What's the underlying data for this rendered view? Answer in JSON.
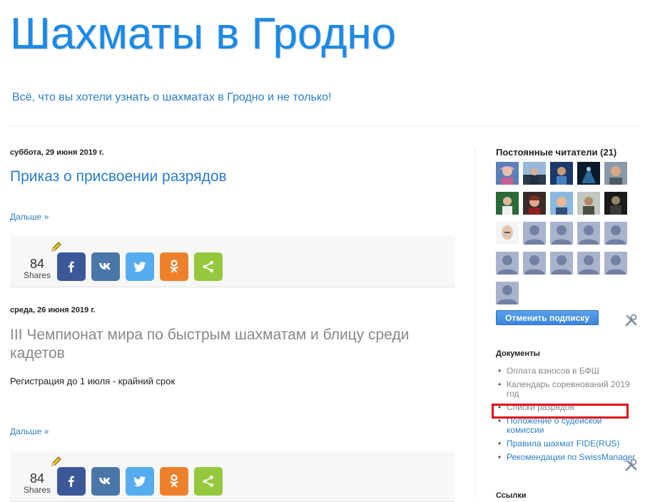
{
  "header": {
    "title": "Шахматы в Гродно",
    "description": "Всё, что вы хотели узнать о шахматах в Гродно и не только!"
  },
  "posts": [
    {
      "date": "суббота, 29 июня 2019 г.",
      "title": "Приказ о присвоении разрядов",
      "snippet": "",
      "more_label": "Дальше »",
      "shares_count": "84",
      "shares_label": "Shares"
    },
    {
      "date": "среда, 26 июня 2019 г.",
      "title": "III Чемпионат мира по быстрым шахматам и блицу среди кадетов",
      "snippet": "Регистрация до 1 июля - крайний срок",
      "more_label": "Дальше »",
      "shares_count": "84",
      "shares_label": "Shares"
    }
  ],
  "share_buttons": [
    {
      "network": "facebook",
      "icon": "facebook-icon",
      "color": "#3b5998"
    },
    {
      "network": "vk",
      "icon": "vk-icon",
      "color": "#4a76a8"
    },
    {
      "network": "twitter",
      "icon": "twitter-icon",
      "color": "#55acee"
    },
    {
      "network": "odnoklassniki",
      "icon": "odnoklassniki-icon",
      "color": "#ed812b"
    },
    {
      "network": "share",
      "icon": "share-icon",
      "color": "#95c83d"
    }
  ],
  "sidebar": {
    "followers": {
      "title": "Постоянные читатели (21)",
      "unsubscribe_label": "Отменить подписку"
    },
    "documents": {
      "title": "Документы",
      "items": [
        {
          "label": "Оплата взносов в БФШ",
          "visited": true
        },
        {
          "label": "Календарь соревнований 2019 год",
          "visited": true
        },
        {
          "label": "Списки разрядов",
          "visited": true
        },
        {
          "label": "Положение о судейской комиссии",
          "visited": false
        },
        {
          "label": "Правила шахмат FIDE(RUS)",
          "visited": false
        },
        {
          "label": "Рекомендации по SwissManager",
          "visited": false
        }
      ]
    },
    "links": {
      "title": "Ссылки"
    }
  },
  "colors": {
    "accent": "#1a8ae8",
    "link": "#2a7ec8",
    "visited": "#888888",
    "highlight": "#e0101c"
  }
}
